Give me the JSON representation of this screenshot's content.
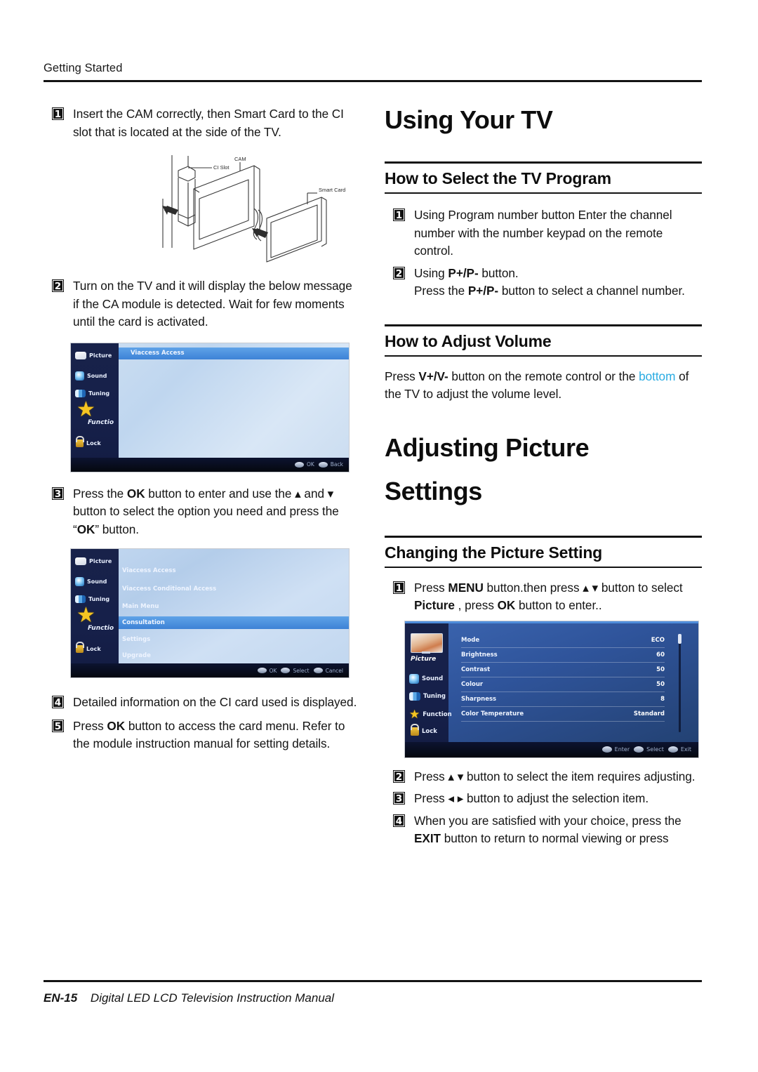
{
  "running_head": "Getting Started",
  "footer": {
    "page": "EN-15",
    "title": "Digital LED LCD Television Instruction Manual"
  },
  "left_column": {
    "steps": [
      {
        "num": "1",
        "text_html": "Insert the CAM correctly, then Smart Card to the CI slot that is located at the side of the TV."
      },
      {
        "num": "2",
        "text_html": "Turn on the TV and it will display the below message if the CA module is detected. Wait for few moments until the card is activated."
      },
      {
        "num": "3",
        "text_html": "Press the <b>OK</b> button to enter and use the ▴ and ▾ button to select the option you need and press the “<b>OK</b>” button."
      },
      {
        "num": "4",
        "text_html": "Detailed information on the CI card used is displayed."
      },
      {
        "num": "5",
        "text_html": "Press <b>OK</b> button to access the card menu. Refer to the module instruction manual for setting details."
      }
    ],
    "cam_diagram": {
      "labels": {
        "ci_slot": "CI Slot",
        "cam": "CAM",
        "smart_card": "Smart Card"
      }
    },
    "screenshot_1": {
      "sidebar": [
        "Picture",
        "Sound",
        "Tuning",
        "Functio",
        "Lock"
      ],
      "title_row": "Viaccess Access",
      "hints": [
        "OK",
        "Back"
      ]
    },
    "screenshot_2": {
      "sidebar": [
        "Picture",
        "Sound",
        "Tuning",
        "Functio",
        "Lock"
      ],
      "rows": [
        "Viaccess Access",
        "Viaccess Conditional Access",
        "Main Menu",
        "Consultation",
        "Settings",
        "Upgrade"
      ],
      "selected_row": "Consultation",
      "hints": [
        "OK",
        "Select",
        "Cancel"
      ]
    }
  },
  "right_column": {
    "title_1": "Using Your TV",
    "section_1": {
      "heading": "How to Select the TV Program",
      "steps": [
        {
          "num": "1",
          "text_html": "Using Program number button Enter the channel number with the number keypad on the remote control."
        },
        {
          "num": "2",
          "text_html": "Using <b>P+/P-</b> button.<br>Press the <b>P+/P-</b> button to select a channel number."
        }
      ]
    },
    "section_2": {
      "heading": "How to Adjust Volume",
      "body_html": "Press <b>V+/V-</b> button on the remote control or the <span class=\"hl\">bottom</span> of the TV to adjust the volume level."
    },
    "title_2_line1": "Adjusting Picture",
    "title_2_line2": "Settings",
    "section_3": {
      "heading": "Changing the Picture Setting",
      "steps_before": [
        {
          "num": "1",
          "text_html": "Press <b>MENU</b> button.then press ▴ ▾ button to select <b>Picture</b> , press <b>OK</b> button to enter.."
        }
      ],
      "steps_after": [
        {
          "num": "2",
          "text_html": "Press ▴ ▾ button to select the item requires adjusting."
        },
        {
          "num": "3",
          "text_html": "Press ◂ ▸ button to adjust the selection item."
        },
        {
          "num": "4",
          "text_html": "When you are satisfied with your choice, press the <b>EXIT</b> button to return to normal viewing or press"
        }
      ]
    },
    "picture_menu_screenshot": {
      "sidebar": [
        "Picture",
        "Sound",
        "Tuning",
        "Function",
        "Lock"
      ],
      "selected_sidebar": "Picture",
      "rows": [
        {
          "label": "Mode",
          "value": "ECO"
        },
        {
          "label": "Brightness",
          "value": "60"
        },
        {
          "label": "Contrast",
          "value": "50"
        },
        {
          "label": "Colour",
          "value": "50"
        },
        {
          "label": "Sharpness",
          "value": "8"
        },
        {
          "label": "Color Temperature",
          "value": "Standard"
        }
      ],
      "hints": [
        "Enter",
        "Select",
        "Exit"
      ]
    }
  },
  "colors": {
    "accent_blue": "#29ABE2",
    "rule": "#141414",
    "osd_dark": "#16204a",
    "osd_highlight": "#4a8ddb"
  }
}
